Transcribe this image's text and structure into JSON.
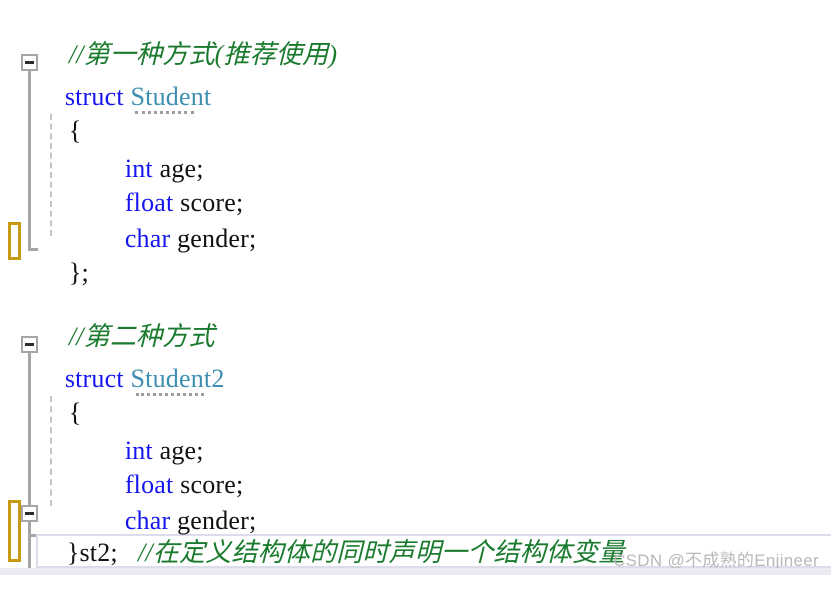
{
  "app": {
    "kind": "code-editor-screenshot",
    "language": "C"
  },
  "colors": {
    "background": "#ffffff",
    "keyword": "#1515f0",
    "identifier": "#111111",
    "type_name": "#3f8fb0",
    "comment": "#1a7a2e",
    "change_bar": "#c79a15",
    "fold_marker": "#a6a6a6",
    "indent_guide": "#c4c4c4",
    "current_line_border": "#dcdcea",
    "watermark": "#b9b9b9"
  },
  "code": {
    "lines": [
      {
        "id": "l1",
        "indent": 1,
        "text": "//第一种方式(推荐使用)",
        "kind": "comment"
      },
      {
        "id": "l2",
        "indent": 0,
        "keyword": "struct",
        "type_name": "Student",
        "kind": "declaration"
      },
      {
        "id": "l3",
        "indent": 1,
        "text": "{",
        "kind": "brace-open"
      },
      {
        "id": "l4",
        "indent": 2,
        "keyword": "int",
        "rest": "age;",
        "kind": "member"
      },
      {
        "id": "l5",
        "indent": 2,
        "keyword": "float",
        "rest": "score;",
        "kind": "member"
      },
      {
        "id": "l6",
        "indent": 2,
        "keyword": "char",
        "rest": "gender;",
        "kind": "member"
      },
      {
        "id": "l7",
        "indent": 1,
        "text": "};",
        "kind": "brace-close"
      },
      {
        "id": "l8",
        "indent": 0,
        "text": "",
        "kind": "blank"
      },
      {
        "id": "l9",
        "indent": 1,
        "text": "//第二种方式",
        "kind": "comment"
      },
      {
        "id": "l10",
        "indent": 0,
        "keyword": "struct",
        "type_name": "Student2",
        "kind": "declaration"
      },
      {
        "id": "l11",
        "indent": 1,
        "text": "{",
        "kind": "brace-open"
      },
      {
        "id": "l12",
        "indent": 2,
        "keyword": "int",
        "rest": "age;",
        "kind": "member"
      },
      {
        "id": "l13",
        "indent": 2,
        "keyword": "float",
        "rest": "score;",
        "kind": "member"
      },
      {
        "id": "l14",
        "indent": 2,
        "keyword": "char",
        "rest": "gender;",
        "kind": "member"
      },
      {
        "id": "l15",
        "indent": 1,
        "code": "}st2;",
        "comment": "//在定义结构体的同时声明一个结构体变量",
        "kind": "brace-close-with-var"
      },
      {
        "id": "l16",
        "indent": 1,
        "text": "",
        "kind": "blank-current-line"
      }
    ],
    "text_l1": "//第一种方式(推荐使用)",
    "text_l2_keyword": "struct",
    "text_l2_type": "Student",
    "text_l3": "{",
    "text_l4_keyword": "int",
    "text_l4_rest": "age;",
    "text_l5_keyword": "float",
    "text_l5_rest": "score;",
    "text_l6_keyword": "char",
    "text_l6_rest": "gender;",
    "text_l7": "};",
    "text_l9": "//第二种方式",
    "text_l10_keyword": "struct",
    "text_l10_type": "Student2",
    "text_l11": "{",
    "text_l12_keyword": "int",
    "text_l12_rest": "age;",
    "text_l13_keyword": "float",
    "text_l13_rest": "score;",
    "text_l14_keyword": "char",
    "text_l14_rest": "gender;",
    "text_l15_code": "}st2;",
    "text_l15_comment": "//在定义结构体的同时声明一个结构体变量"
  },
  "gutter": {
    "fold_markers": [
      {
        "id": "fold-struct-student",
        "state": "expanded",
        "glyph": "minus"
      },
      {
        "id": "fold-struct-student2",
        "state": "expanded",
        "glyph": "minus"
      },
      {
        "id": "fold-struct-student2-end",
        "state": "expanded",
        "glyph": "minus"
      }
    ],
    "change_bars": [
      {
        "id": "change-bar-upper"
      },
      {
        "id": "change-bar-lower"
      }
    ]
  },
  "watermark": {
    "text": "CSDN @不成熟的Enjineer"
  }
}
